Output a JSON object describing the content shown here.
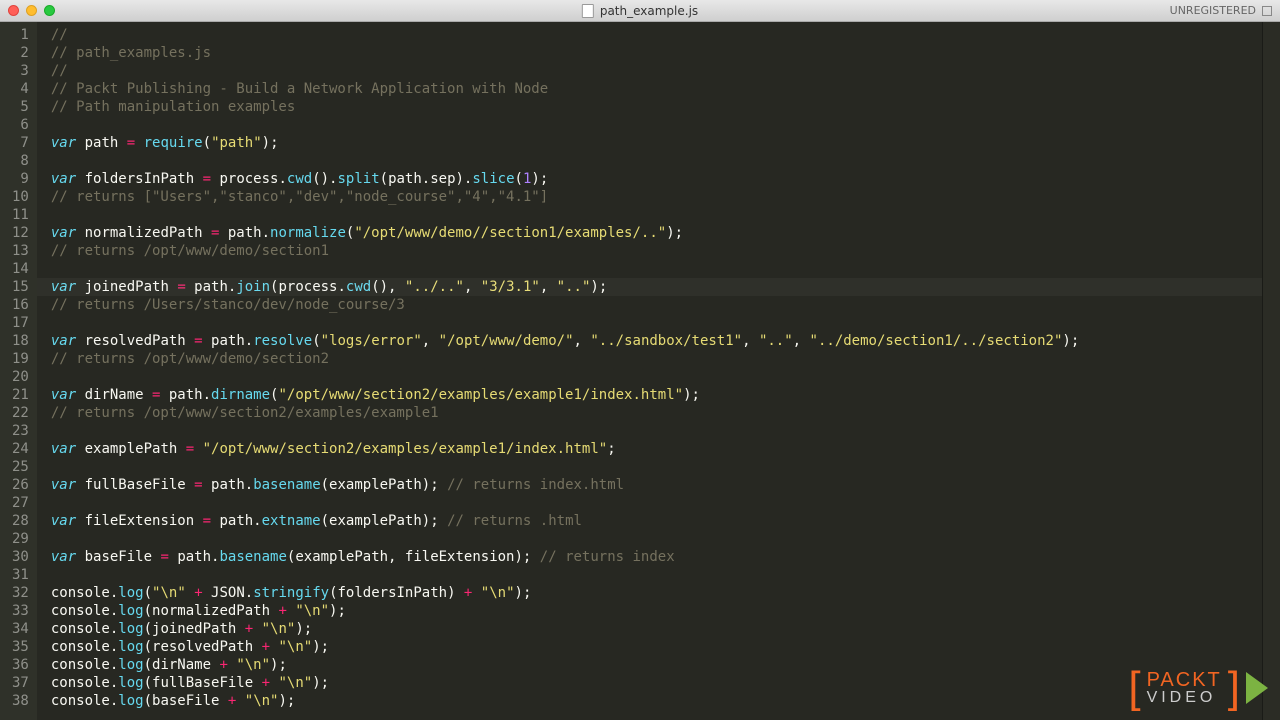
{
  "window": {
    "filename": "path_example.js",
    "status_right": "UNREGISTERED"
  },
  "watermark": {
    "brand": "PACKT",
    "sub": "VIDEO"
  },
  "highlighted_line": 15,
  "code": {
    "lines": [
      {
        "n": 1,
        "tokens": [
          {
            "t": "//",
            "c": "comment"
          }
        ]
      },
      {
        "n": 2,
        "tokens": [
          {
            "t": "// path_examples.js",
            "c": "comment"
          }
        ]
      },
      {
        "n": 3,
        "tokens": [
          {
            "t": "//",
            "c": "comment"
          }
        ]
      },
      {
        "n": 4,
        "tokens": [
          {
            "t": "// Packt Publishing - Build a Network Application with Node",
            "c": "comment"
          }
        ]
      },
      {
        "n": 5,
        "tokens": [
          {
            "t": "// Path manipulation examples",
            "c": "comment"
          }
        ]
      },
      {
        "n": 6,
        "tokens": []
      },
      {
        "n": 7,
        "tokens": [
          {
            "t": "var",
            "c": "storage"
          },
          {
            "t": " path ",
            "c": "var"
          },
          {
            "t": "=",
            "c": "op"
          },
          {
            "t": " ",
            "c": "var"
          },
          {
            "t": "require",
            "c": "func"
          },
          {
            "t": "(",
            "c": "punct"
          },
          {
            "t": "\"path\"",
            "c": "string"
          },
          {
            "t": ")",
            "c": "punct"
          },
          {
            "t": ";",
            "c": "punct"
          }
        ]
      },
      {
        "n": 8,
        "tokens": []
      },
      {
        "n": 9,
        "tokens": [
          {
            "t": "var",
            "c": "storage"
          },
          {
            "t": " foldersInPath ",
            "c": "var"
          },
          {
            "t": "=",
            "c": "op"
          },
          {
            "t": " process.",
            "c": "var"
          },
          {
            "t": "cwd",
            "c": "func"
          },
          {
            "t": "().",
            "c": "punct"
          },
          {
            "t": "split",
            "c": "func"
          },
          {
            "t": "(path.sep).",
            "c": "var"
          },
          {
            "t": "slice",
            "c": "func"
          },
          {
            "t": "(",
            "c": "punct"
          },
          {
            "t": "1",
            "c": "number"
          },
          {
            "t": ");",
            "c": "punct"
          }
        ]
      },
      {
        "n": 10,
        "tokens": [
          {
            "t": "// returns [\"Users\",\"stanco\",\"dev\",\"node_course\",\"4\",\"4.1\"]",
            "c": "comment"
          }
        ]
      },
      {
        "n": 11,
        "tokens": []
      },
      {
        "n": 12,
        "tokens": [
          {
            "t": "var",
            "c": "storage"
          },
          {
            "t": " normalizedPath ",
            "c": "var"
          },
          {
            "t": "=",
            "c": "op"
          },
          {
            "t": " path.",
            "c": "var"
          },
          {
            "t": "normalize",
            "c": "func"
          },
          {
            "t": "(",
            "c": "punct"
          },
          {
            "t": "\"/opt/www/demo//section1/examples/..\"",
            "c": "string"
          },
          {
            "t": ");",
            "c": "punct"
          }
        ]
      },
      {
        "n": 13,
        "tokens": [
          {
            "t": "// returns /opt/www/demo/section1",
            "c": "comment"
          }
        ]
      },
      {
        "n": 14,
        "tokens": []
      },
      {
        "n": 15,
        "tokens": [
          {
            "t": "var",
            "c": "storage"
          },
          {
            "t": " joinedPath ",
            "c": "var"
          },
          {
            "t": "=",
            "c": "op"
          },
          {
            "t": " path.",
            "c": "var"
          },
          {
            "t": "join",
            "c": "func"
          },
          {
            "t": "(process.",
            "c": "var"
          },
          {
            "t": "cwd",
            "c": "func"
          },
          {
            "t": "(), ",
            "c": "var"
          },
          {
            "t": "\"../..\"",
            "c": "string"
          },
          {
            "t": ", ",
            "c": "punct"
          },
          {
            "t": "\"3/3.1\"",
            "c": "string"
          },
          {
            "t": ", ",
            "c": "punct"
          },
          {
            "t": "\"..\"",
            "c": "string"
          },
          {
            "t": ");",
            "c": "punct"
          }
        ]
      },
      {
        "n": 16,
        "tokens": [
          {
            "t": "// returns /Users/stanco/dev/node_course/3",
            "c": "comment"
          }
        ]
      },
      {
        "n": 17,
        "tokens": []
      },
      {
        "n": 18,
        "tokens": [
          {
            "t": "var",
            "c": "storage"
          },
          {
            "t": " resolvedPath ",
            "c": "var"
          },
          {
            "t": "=",
            "c": "op"
          },
          {
            "t": " path.",
            "c": "var"
          },
          {
            "t": "resolve",
            "c": "func"
          },
          {
            "t": "(",
            "c": "punct"
          },
          {
            "t": "\"logs/error\"",
            "c": "string"
          },
          {
            "t": ", ",
            "c": "punct"
          },
          {
            "t": "\"/opt/www/demo/\"",
            "c": "string"
          },
          {
            "t": ", ",
            "c": "punct"
          },
          {
            "t": "\"../sandbox/test1\"",
            "c": "string"
          },
          {
            "t": ", ",
            "c": "punct"
          },
          {
            "t": "\"..\"",
            "c": "string"
          },
          {
            "t": ", ",
            "c": "punct"
          },
          {
            "t": "\"../demo/section1/../section2\"",
            "c": "string"
          },
          {
            "t": ");",
            "c": "punct"
          }
        ]
      },
      {
        "n": 19,
        "tokens": [
          {
            "t": "// returns /opt/www/demo/section2",
            "c": "comment"
          }
        ]
      },
      {
        "n": 20,
        "tokens": []
      },
      {
        "n": 21,
        "tokens": [
          {
            "t": "var",
            "c": "storage"
          },
          {
            "t": " dirName ",
            "c": "var"
          },
          {
            "t": "=",
            "c": "op"
          },
          {
            "t": " path.",
            "c": "var"
          },
          {
            "t": "dirname",
            "c": "func"
          },
          {
            "t": "(",
            "c": "punct"
          },
          {
            "t": "\"/opt/www/section2/examples/example1/index.html\"",
            "c": "string"
          },
          {
            "t": ");",
            "c": "punct"
          }
        ]
      },
      {
        "n": 22,
        "tokens": [
          {
            "t": "// returns /opt/www/section2/examples/example1",
            "c": "comment"
          }
        ]
      },
      {
        "n": 23,
        "tokens": []
      },
      {
        "n": 24,
        "tokens": [
          {
            "t": "var",
            "c": "storage"
          },
          {
            "t": " examplePath ",
            "c": "var"
          },
          {
            "t": "=",
            "c": "op"
          },
          {
            "t": " ",
            "c": "var"
          },
          {
            "t": "\"/opt/www/section2/examples/example1/index.html\"",
            "c": "string"
          },
          {
            "t": ";",
            "c": "punct"
          }
        ]
      },
      {
        "n": 25,
        "tokens": []
      },
      {
        "n": 26,
        "tokens": [
          {
            "t": "var",
            "c": "storage"
          },
          {
            "t": " fullBaseFile ",
            "c": "var"
          },
          {
            "t": "=",
            "c": "op"
          },
          {
            "t": " path.",
            "c": "var"
          },
          {
            "t": "basename",
            "c": "func"
          },
          {
            "t": "(examplePath); ",
            "c": "var"
          },
          {
            "t": "// returns index.html",
            "c": "comment"
          }
        ]
      },
      {
        "n": 27,
        "tokens": []
      },
      {
        "n": 28,
        "tokens": [
          {
            "t": "var",
            "c": "storage"
          },
          {
            "t": " fileExtension ",
            "c": "var"
          },
          {
            "t": "=",
            "c": "op"
          },
          {
            "t": " path.",
            "c": "var"
          },
          {
            "t": "extname",
            "c": "func"
          },
          {
            "t": "(examplePath); ",
            "c": "var"
          },
          {
            "t": "// returns .html",
            "c": "comment"
          }
        ]
      },
      {
        "n": 29,
        "tokens": []
      },
      {
        "n": 30,
        "tokens": [
          {
            "t": "var",
            "c": "storage"
          },
          {
            "t": " baseFile ",
            "c": "var"
          },
          {
            "t": "=",
            "c": "op"
          },
          {
            "t": " path.",
            "c": "var"
          },
          {
            "t": "basename",
            "c": "func"
          },
          {
            "t": "(examplePath, fileExtension); ",
            "c": "var"
          },
          {
            "t": "// returns index",
            "c": "comment"
          }
        ]
      },
      {
        "n": 31,
        "tokens": []
      },
      {
        "n": 32,
        "tokens": [
          {
            "t": "console.",
            "c": "var"
          },
          {
            "t": "log",
            "c": "func"
          },
          {
            "t": "(",
            "c": "punct"
          },
          {
            "t": "\"\\n\"",
            "c": "string"
          },
          {
            "t": " ",
            "c": "var"
          },
          {
            "t": "+",
            "c": "op"
          },
          {
            "t": " JSON.",
            "c": "var"
          },
          {
            "t": "stringify",
            "c": "func"
          },
          {
            "t": "(foldersInPath) ",
            "c": "var"
          },
          {
            "t": "+",
            "c": "op"
          },
          {
            "t": " ",
            "c": "var"
          },
          {
            "t": "\"\\n\"",
            "c": "string"
          },
          {
            "t": ");",
            "c": "punct"
          }
        ]
      },
      {
        "n": 33,
        "tokens": [
          {
            "t": "console.",
            "c": "var"
          },
          {
            "t": "log",
            "c": "func"
          },
          {
            "t": "(normalizedPath ",
            "c": "var"
          },
          {
            "t": "+",
            "c": "op"
          },
          {
            "t": " ",
            "c": "var"
          },
          {
            "t": "\"\\n\"",
            "c": "string"
          },
          {
            "t": ");",
            "c": "punct"
          }
        ]
      },
      {
        "n": 34,
        "tokens": [
          {
            "t": "console.",
            "c": "var"
          },
          {
            "t": "log",
            "c": "func"
          },
          {
            "t": "(joinedPath ",
            "c": "var"
          },
          {
            "t": "+",
            "c": "op"
          },
          {
            "t": " ",
            "c": "var"
          },
          {
            "t": "\"\\n\"",
            "c": "string"
          },
          {
            "t": ");",
            "c": "punct"
          }
        ]
      },
      {
        "n": 35,
        "tokens": [
          {
            "t": "console.",
            "c": "var"
          },
          {
            "t": "log",
            "c": "func"
          },
          {
            "t": "(resolvedPath ",
            "c": "var"
          },
          {
            "t": "+",
            "c": "op"
          },
          {
            "t": " ",
            "c": "var"
          },
          {
            "t": "\"\\n\"",
            "c": "string"
          },
          {
            "t": ");",
            "c": "punct"
          }
        ]
      },
      {
        "n": 36,
        "tokens": [
          {
            "t": "console.",
            "c": "var"
          },
          {
            "t": "log",
            "c": "func"
          },
          {
            "t": "(dirName ",
            "c": "var"
          },
          {
            "t": "+",
            "c": "op"
          },
          {
            "t": " ",
            "c": "var"
          },
          {
            "t": "\"\\n\"",
            "c": "string"
          },
          {
            "t": ");",
            "c": "punct"
          }
        ]
      },
      {
        "n": 37,
        "tokens": [
          {
            "t": "console.",
            "c": "var"
          },
          {
            "t": "log",
            "c": "func"
          },
          {
            "t": "(fullBaseFile ",
            "c": "var"
          },
          {
            "t": "+",
            "c": "op"
          },
          {
            "t": " ",
            "c": "var"
          },
          {
            "t": "\"\\n\"",
            "c": "string"
          },
          {
            "t": ");",
            "c": "punct"
          }
        ]
      },
      {
        "n": 38,
        "tokens": [
          {
            "t": "console.",
            "c": "var"
          },
          {
            "t": "log",
            "c": "func"
          },
          {
            "t": "(baseFile ",
            "c": "var"
          },
          {
            "t": "+",
            "c": "op"
          },
          {
            "t": " ",
            "c": "var"
          },
          {
            "t": "\"\\n\"",
            "c": "string"
          },
          {
            "t": ");",
            "c": "punct"
          }
        ]
      }
    ]
  }
}
